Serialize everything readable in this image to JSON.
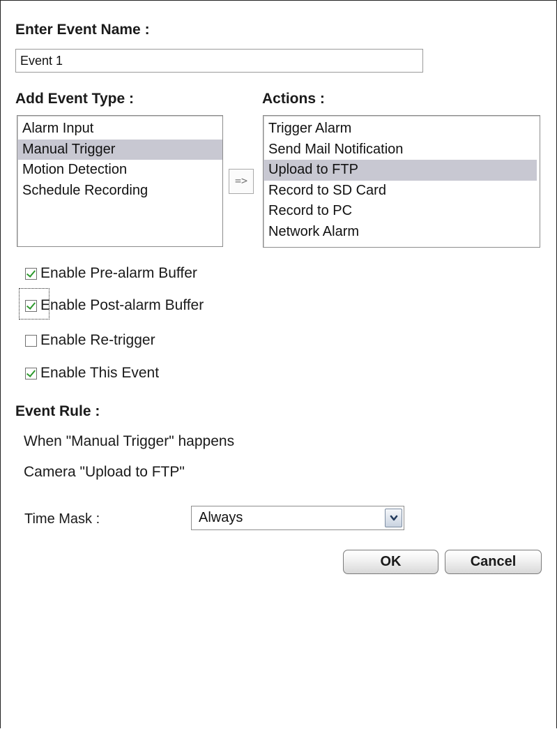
{
  "event_name": {
    "label": "Enter Event Name :",
    "value": "Event 1"
  },
  "event_type": {
    "label": "Add Event Type :",
    "options": [
      "Alarm Input",
      "Manual Trigger",
      "Motion Detection",
      "Schedule Recording"
    ],
    "selected": "Manual Trigger"
  },
  "add_button": {
    "label": "=>"
  },
  "actions": {
    "label": "Actions :",
    "options": [
      "Trigger Alarm",
      "Send Mail Notification",
      "Upload to FTP",
      "Record to SD Card",
      "Record to PC",
      "Network Alarm"
    ],
    "selected": "Upload to FTP"
  },
  "options": {
    "pre_alarm": {
      "label": "Enable Pre-alarm Buffer",
      "checked": true
    },
    "post_alarm": {
      "label": "Enable Post-alarm Buffer",
      "checked": true
    },
    "retrigger": {
      "label": "Enable Re-trigger",
      "checked": false
    },
    "enable_event": {
      "label": "Enable This Event",
      "checked": true
    }
  },
  "event_rule": {
    "label": "Event Rule :",
    "when_text": "When \"Manual Trigger\" happens",
    "camera_text": "Camera \"Upload to FTP\""
  },
  "time_mask": {
    "label": "Time Mask :",
    "value": "Always",
    "arrow": "chevron-down-icon"
  },
  "buttons": {
    "ok": "OK",
    "cancel": "Cancel"
  },
  "colors": {
    "selection": "#c8c8d2",
    "checkmark": "#2d9a2d"
  }
}
